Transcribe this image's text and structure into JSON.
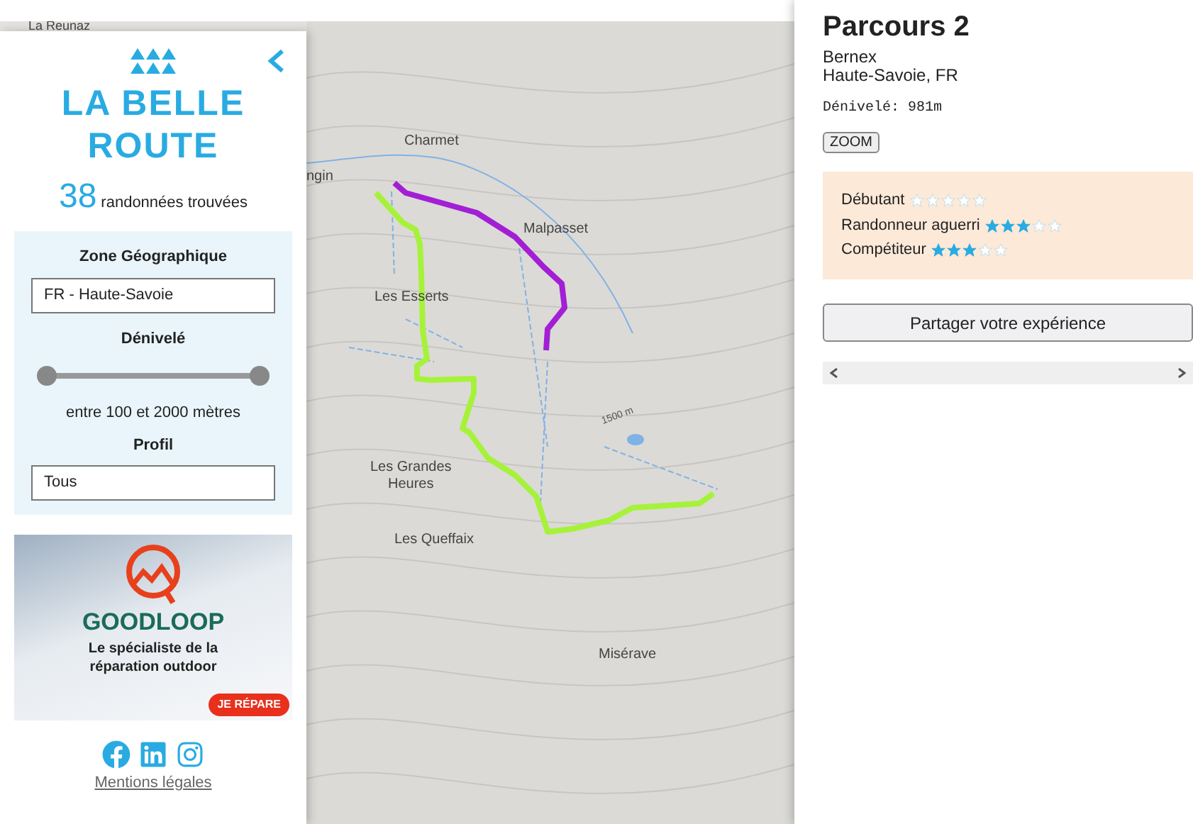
{
  "map": {
    "top_label": "La Reunaz",
    "labels": [
      {
        "text": "ngin"
      },
      {
        "text": "Charmet"
      },
      {
        "text": "Malpasset"
      },
      {
        "text": "Les Esserts"
      },
      {
        "text": "Les Grandes\nHeures"
      },
      {
        "text": "Les Queffaix"
      },
      {
        "text": "Misérave"
      }
    ],
    "elevation": "1500 m"
  },
  "sidebar": {
    "logo": "LA BELLE\nROUTE",
    "count": "38",
    "count_label": "randonnées trouvées",
    "filters": {
      "zone_label": "Zone Géographique",
      "zone_value": "FR - Haute-Savoie",
      "elevation_label": "Dénivelé",
      "thumbs": [
        {
          "level": 0
        },
        {
          "level": 1
        }
      ],
      "elevation_range": "entre 100 et 2000 mètres",
      "profile_label": "Profil",
      "profile_value": "Tous"
    },
    "ad": {
      "brand": "GOODLOOP",
      "tagline": "Le spécialiste de la\nréparation outdoor",
      "button": "JE RÉPARE"
    },
    "footer_link": "Mentions légales"
  },
  "detail": {
    "title": "Parcours 2",
    "place": "Bernex",
    "region": "Haute-Savoie, FR",
    "elevation": "Dénivelé: 981m",
    "zoom_button": "ZOOM",
    "ratings": [
      {
        "label": "Débutant",
        "stars": 0
      },
      {
        "label": "Randonneur aguerri",
        "stars": 3
      },
      {
        "label": "Compétiteur",
        "stars": 3
      }
    ],
    "share_button": "Partager votre expérience"
  }
}
